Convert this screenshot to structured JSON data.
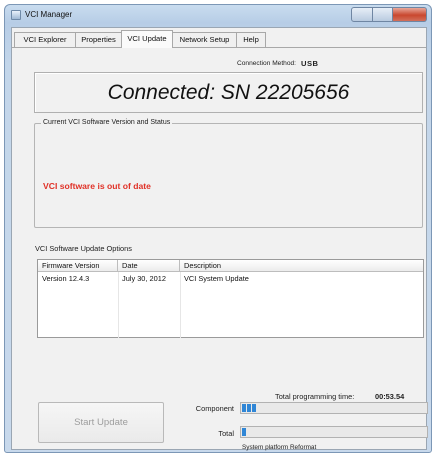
{
  "window": {
    "title": "VCI Manager"
  },
  "tabs": [
    {
      "label": "VCI Explorer",
      "active": false
    },
    {
      "label": "Properties",
      "active": false
    },
    {
      "label": "VCI Update",
      "active": true
    },
    {
      "label": "Network Setup",
      "active": false
    },
    {
      "label": "Help",
      "active": false
    }
  ],
  "connection": {
    "method_label": "Connection Method:",
    "method_value": "USB",
    "status_text": "Connected: SN 22205656"
  },
  "version_status": {
    "group_label": "Current VCI Software Version and Status",
    "message": "VCI software is out of date",
    "message_color": "#e03127"
  },
  "update_options": {
    "label": "VCI Software Update Options",
    "columns": [
      "Firmware Version",
      "Date",
      "Description"
    ],
    "rows": [
      {
        "firmware_version": "Version 12.4.3",
        "date": "July 30, 2012",
        "description": "VCI System Update"
      }
    ]
  },
  "programming": {
    "total_time_label": "Total programming time:",
    "total_time_value": "00:53.54",
    "start_button_label": "Start Update",
    "component_label": "Component",
    "component_progress": 0.09,
    "total_label": "Total",
    "total_progress": 0.03,
    "stage_text": "System platform Reformat",
    "progress_color": "#2f86d6"
  }
}
